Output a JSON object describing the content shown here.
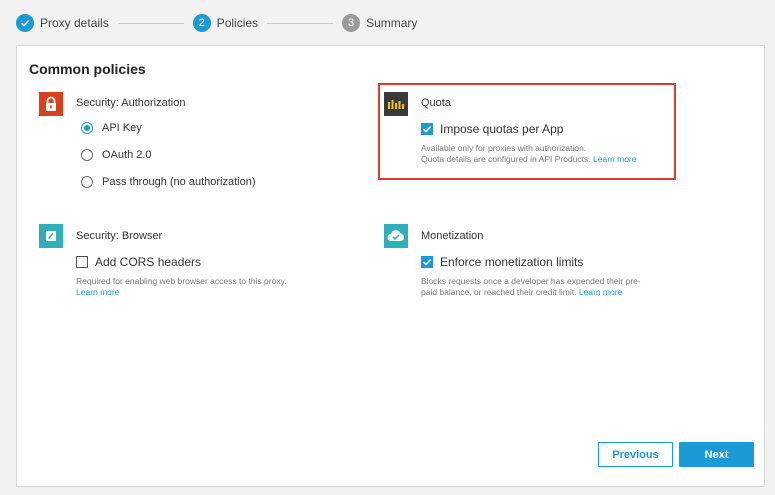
{
  "stepper": {
    "steps": [
      {
        "label": "Proxy details",
        "number": "",
        "state": "done"
      },
      {
        "label": "Policies",
        "number": "2",
        "state": "active"
      },
      {
        "label": "Summary",
        "number": "3",
        "state": "todo"
      }
    ]
  },
  "card": {
    "title": "Common policies"
  },
  "authorization": {
    "title": "Security: Authorization",
    "icon": "lock-icon",
    "options": [
      {
        "label": "API Key",
        "selected": true
      },
      {
        "label": "OAuth 2.0",
        "selected": false
      },
      {
        "label": "Pass through (no authorization)",
        "selected": false
      }
    ]
  },
  "quota": {
    "title": "Quota",
    "icon": "bar-chart-icon",
    "checkbox_label": "Impose quotas per App",
    "checked": true,
    "help_line1": "Available only for proxies with authorization.",
    "help_line2": "Quota details are configured in API Products.",
    "learn_more": "Learn more"
  },
  "browser": {
    "title": "Security: Browser",
    "icon": "pencil-icon",
    "checkbox_label": "Add CORS headers",
    "checked": false,
    "help_line1": "Required for enabling web browser access to this proxy.",
    "learn_more": "Learn more"
  },
  "monetization": {
    "title": "Monetization",
    "icon": "cloud-check-icon",
    "checkbox_label": "Enforce monetization limits",
    "checked": true,
    "help_line1": "Blocks requests once a developer has expended their pre-",
    "help_line2": "paid balance, or reached their credit limit.",
    "learn_more": "Learn more"
  },
  "actions": {
    "previous_label": "Previous",
    "next_label": "Next"
  },
  "colors": {
    "accent": "#1a9ad6",
    "highlight": "#e03a2b",
    "lock_bg": "#d9401e",
    "quota_bg": "#3a3a3a",
    "teal_bg": "#2fb0b8"
  }
}
